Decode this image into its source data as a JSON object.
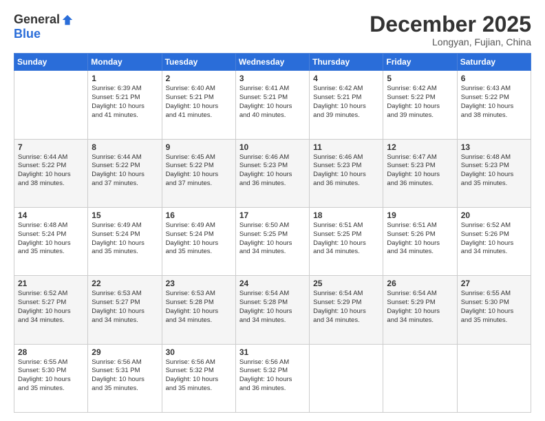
{
  "logo": {
    "general": "General",
    "blue": "Blue"
  },
  "header": {
    "month": "December 2025",
    "location": "Longyan, Fujian, China"
  },
  "weekdays": [
    "Sunday",
    "Monday",
    "Tuesday",
    "Wednesday",
    "Thursday",
    "Friday",
    "Saturday"
  ],
  "weeks": [
    [
      {
        "day": "",
        "info": ""
      },
      {
        "day": "1",
        "info": "Sunrise: 6:39 AM\nSunset: 5:21 PM\nDaylight: 10 hours\nand 41 minutes."
      },
      {
        "day": "2",
        "info": "Sunrise: 6:40 AM\nSunset: 5:21 PM\nDaylight: 10 hours\nand 41 minutes."
      },
      {
        "day": "3",
        "info": "Sunrise: 6:41 AM\nSunset: 5:21 PM\nDaylight: 10 hours\nand 40 minutes."
      },
      {
        "day": "4",
        "info": "Sunrise: 6:42 AM\nSunset: 5:21 PM\nDaylight: 10 hours\nand 39 minutes."
      },
      {
        "day": "5",
        "info": "Sunrise: 6:42 AM\nSunset: 5:22 PM\nDaylight: 10 hours\nand 39 minutes."
      },
      {
        "day": "6",
        "info": "Sunrise: 6:43 AM\nSunset: 5:22 PM\nDaylight: 10 hours\nand 38 minutes."
      }
    ],
    [
      {
        "day": "7",
        "info": "Sunrise: 6:44 AM\nSunset: 5:22 PM\nDaylight: 10 hours\nand 38 minutes."
      },
      {
        "day": "8",
        "info": "Sunrise: 6:44 AM\nSunset: 5:22 PM\nDaylight: 10 hours\nand 37 minutes."
      },
      {
        "day": "9",
        "info": "Sunrise: 6:45 AM\nSunset: 5:22 PM\nDaylight: 10 hours\nand 37 minutes."
      },
      {
        "day": "10",
        "info": "Sunrise: 6:46 AM\nSunset: 5:23 PM\nDaylight: 10 hours\nand 36 minutes."
      },
      {
        "day": "11",
        "info": "Sunrise: 6:46 AM\nSunset: 5:23 PM\nDaylight: 10 hours\nand 36 minutes."
      },
      {
        "day": "12",
        "info": "Sunrise: 6:47 AM\nSunset: 5:23 PM\nDaylight: 10 hours\nand 36 minutes."
      },
      {
        "day": "13",
        "info": "Sunrise: 6:48 AM\nSunset: 5:23 PM\nDaylight: 10 hours\nand 35 minutes."
      }
    ],
    [
      {
        "day": "14",
        "info": "Sunrise: 6:48 AM\nSunset: 5:24 PM\nDaylight: 10 hours\nand 35 minutes."
      },
      {
        "day": "15",
        "info": "Sunrise: 6:49 AM\nSunset: 5:24 PM\nDaylight: 10 hours\nand 35 minutes."
      },
      {
        "day": "16",
        "info": "Sunrise: 6:49 AM\nSunset: 5:24 PM\nDaylight: 10 hours\nand 35 minutes."
      },
      {
        "day": "17",
        "info": "Sunrise: 6:50 AM\nSunset: 5:25 PM\nDaylight: 10 hours\nand 34 minutes."
      },
      {
        "day": "18",
        "info": "Sunrise: 6:51 AM\nSunset: 5:25 PM\nDaylight: 10 hours\nand 34 minutes."
      },
      {
        "day": "19",
        "info": "Sunrise: 6:51 AM\nSunset: 5:26 PM\nDaylight: 10 hours\nand 34 minutes."
      },
      {
        "day": "20",
        "info": "Sunrise: 6:52 AM\nSunset: 5:26 PM\nDaylight: 10 hours\nand 34 minutes."
      }
    ],
    [
      {
        "day": "21",
        "info": "Sunrise: 6:52 AM\nSunset: 5:27 PM\nDaylight: 10 hours\nand 34 minutes."
      },
      {
        "day": "22",
        "info": "Sunrise: 6:53 AM\nSunset: 5:27 PM\nDaylight: 10 hours\nand 34 minutes."
      },
      {
        "day": "23",
        "info": "Sunrise: 6:53 AM\nSunset: 5:28 PM\nDaylight: 10 hours\nand 34 minutes."
      },
      {
        "day": "24",
        "info": "Sunrise: 6:54 AM\nSunset: 5:28 PM\nDaylight: 10 hours\nand 34 minutes."
      },
      {
        "day": "25",
        "info": "Sunrise: 6:54 AM\nSunset: 5:29 PM\nDaylight: 10 hours\nand 34 minutes."
      },
      {
        "day": "26",
        "info": "Sunrise: 6:54 AM\nSunset: 5:29 PM\nDaylight: 10 hours\nand 34 minutes."
      },
      {
        "day": "27",
        "info": "Sunrise: 6:55 AM\nSunset: 5:30 PM\nDaylight: 10 hours\nand 35 minutes."
      }
    ],
    [
      {
        "day": "28",
        "info": "Sunrise: 6:55 AM\nSunset: 5:30 PM\nDaylight: 10 hours\nand 35 minutes."
      },
      {
        "day": "29",
        "info": "Sunrise: 6:56 AM\nSunset: 5:31 PM\nDaylight: 10 hours\nand 35 minutes."
      },
      {
        "day": "30",
        "info": "Sunrise: 6:56 AM\nSunset: 5:32 PM\nDaylight: 10 hours\nand 35 minutes."
      },
      {
        "day": "31",
        "info": "Sunrise: 6:56 AM\nSunset: 5:32 PM\nDaylight: 10 hours\nand 36 minutes."
      },
      {
        "day": "",
        "info": ""
      },
      {
        "day": "",
        "info": ""
      },
      {
        "day": "",
        "info": ""
      }
    ]
  ]
}
